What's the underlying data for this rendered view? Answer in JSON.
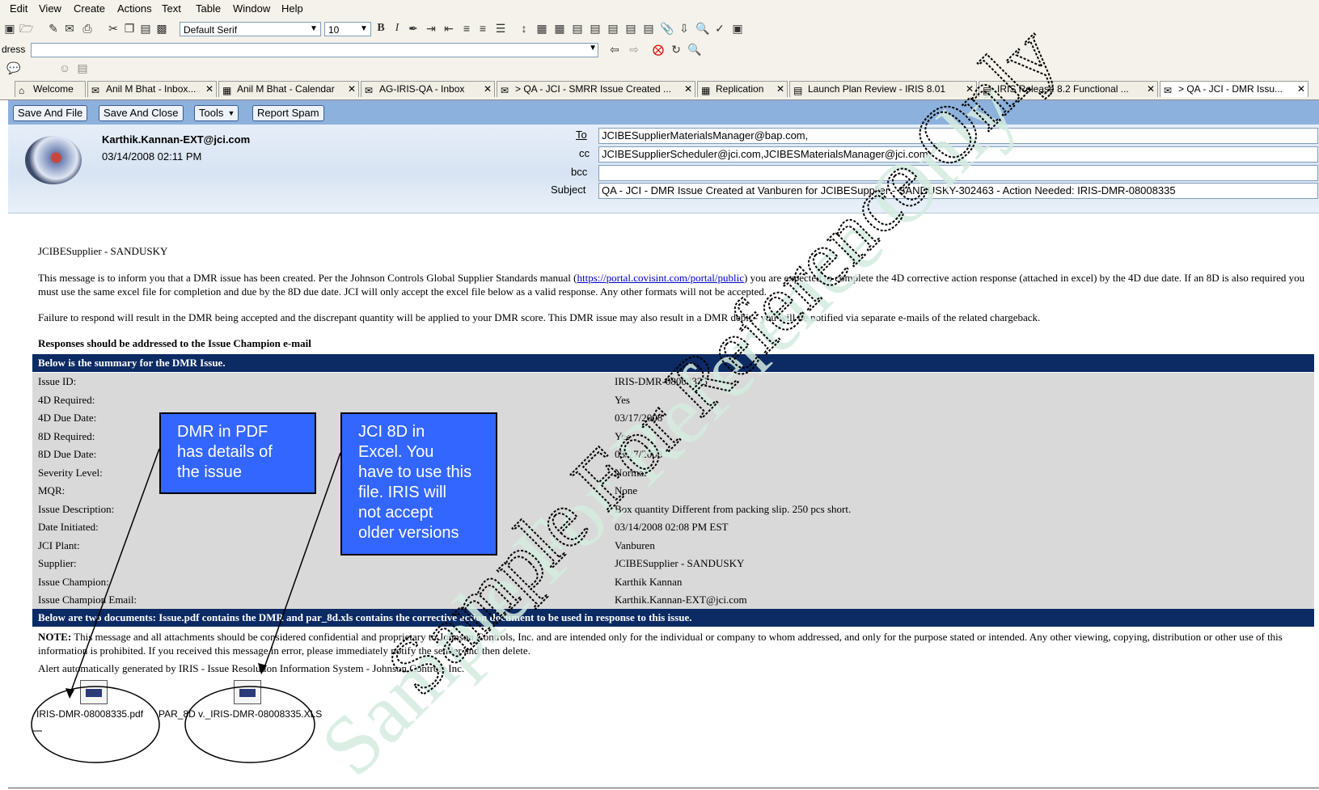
{
  "menu": [
    "Edit",
    "View",
    "Create",
    "Actions",
    "Text",
    "Table",
    "Window",
    "Help"
  ],
  "toolbar": {
    "font_name": "Default Serif",
    "font_size": "10"
  },
  "address": {
    "label": "dress",
    "value": ""
  },
  "tabs": [
    {
      "label": "Welcome"
    },
    {
      "label": "Anil M Bhat - Inbox..."
    },
    {
      "label": "Anil M Bhat - Calendar"
    },
    {
      "label": "AG-IRIS-QA - Inbox"
    },
    {
      "label": "> QA - JCI - SMRR Issue Created ..."
    },
    {
      "label": "Replication"
    },
    {
      "label": "Launch Plan Review - IRIS 8.01"
    },
    {
      "label": "IRIS Release 8.2 Functional ..."
    },
    {
      "label": "> QA - JCI - DMR Issu..."
    }
  ],
  "actions": {
    "save_file": "Save And File",
    "save_close": "Save And Close",
    "tools": "Tools",
    "report_spam": "Report Spam"
  },
  "email": {
    "sender": "Karthik.Kannan-EXT@jci.com",
    "date": "03/14/2008 02:11 PM",
    "to_label": "To",
    "to": "JCIBESupplierMaterialsManager@bap.com,",
    "cc_label": "cc",
    "cc": "JCIBESupplierScheduler@jci.com,JCIBESMaterialsManager@jci.com,",
    "bcc_label": "bcc",
    "bcc": "",
    "subject_label": "Subject",
    "subject": "QA - JCI - DMR Issue Created at Vanburen for JCIBESupplier - SANDUSKY-302463  - Action Needed: IRIS-DMR-08008335"
  },
  "body": {
    "greeting": "JCIBESupplier - SANDUSKY",
    "para1_a": "This message is to inform you that a DMR issue has been created. Per the Johnson Controls Global Supplier Standards manual (",
    "para1_link": "https://portal.covisint.com/portal/public",
    "para1_b": ") you are expected to complete the 4D corrective action response (attached in excel) by the 4D due date. If an 8D is also required you must use the same excel file for completion and due by the 8D due date. JCI will only accept the excel file below as a valid response. Any other formats will not be accepted.",
    "para2": "Failure to respond will result in the DMR being accepted and the discrepant quantity will be applied to your DMR score. This DMR issue may also result in a DMR debit - you will be notified via separate e-mails of the related chargeback.",
    "responses": "Responses should be addressed to the Issue Champion e-mail",
    "summary_header": "Below is the summary for the DMR Issue.",
    "summary": [
      {
        "key": "Issue ID:",
        "value": "IRIS-DMR-08008335"
      },
      {
        "key": "4D Required:",
        "value": "Yes"
      },
      {
        "key": "4D Due Date:",
        "value": "03/17/2008"
      },
      {
        "key": "8D Required:",
        "value": "Yes"
      },
      {
        "key": "8D Due Date:",
        "value": "03/27/2008"
      },
      {
        "key": "Severity Level:",
        "value": "Normal"
      },
      {
        "key": "MQR:",
        "value": "None"
      },
      {
        "key": "Issue Description:",
        "value": "Box quantity Different from packing slip. 250 pcs short."
      },
      {
        "key": "Date Initiated:",
        "value": "03/14/2008 02:08 PM EST"
      },
      {
        "key": "JCI Plant:",
        "value": "Vanburen"
      },
      {
        "key": "Supplier:",
        "value": "JCIBESupplier - SANDUSKY"
      },
      {
        "key": "Issue Champion:",
        "value": "Karthik Kannan"
      },
      {
        "key": "Issue Champion Email:",
        "value": "Karthik.Kannan-EXT@jci.com"
      }
    ],
    "docs_header": "Below are two documents: Issue.pdf contains the DMR and par_8d.xls contains the corrective action document to be used in response to this issue.",
    "note_label": "NOTE:",
    "note": " This message and all attachments should be considered confidential and proprietary to Johnson Controls, Inc. and are intended only for the individual or company to whom addressed, and only for the purpose stated or intended. Any other viewing, copying, distribution or other use of this information is prohibited. If you received this message in error, please immediately notify the sender and then delete.",
    "alert": "Alert automatically generated by IRIS - Issue Resolution Information System - Johnson Controls Inc."
  },
  "attachments": [
    {
      "name": "IRIS-DMR-08008335.pdf"
    },
    {
      "name": "PAR_8D v._IRIS-DMR-08008335.XLS"
    }
  ],
  "callouts": {
    "pdf": [
      "DMR in PDF",
      "has details of",
      "the issue"
    ],
    "xls": [
      "JCI 8D in",
      "Excel. You",
      "have to use this",
      "file. IRIS will",
      "not accept",
      "older versions"
    ]
  },
  "watermark": {
    "line1": "Sample For Reference Only",
    "line2": "Sample For Reference Only"
  },
  "colors": {
    "band": "#0c2a63",
    "callout": "#3366ff",
    "actionbar": "#8db1dd"
  }
}
